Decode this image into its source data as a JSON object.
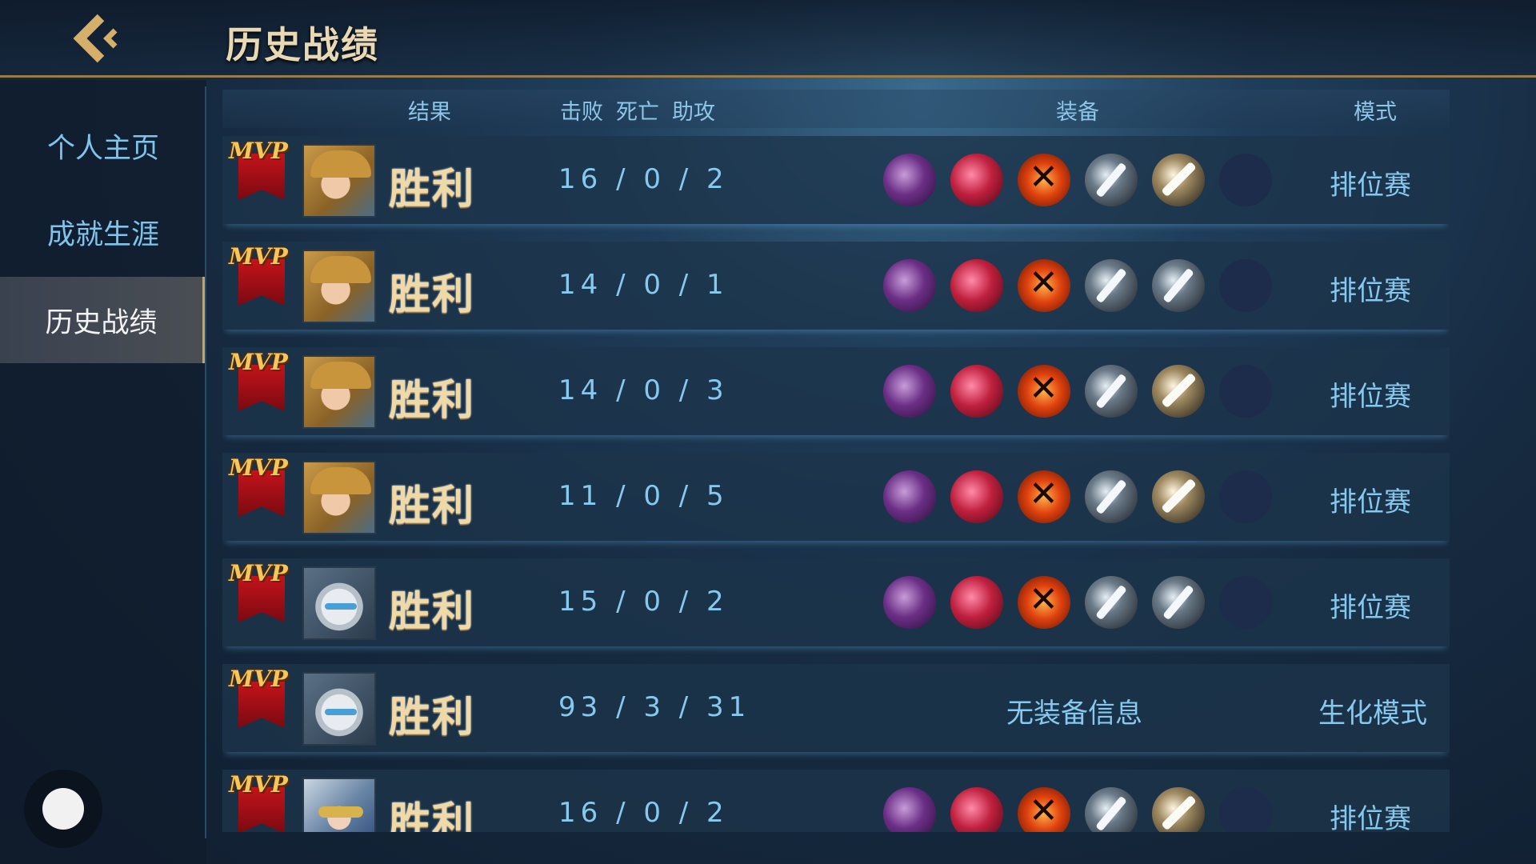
{
  "header": {
    "title": "历史战绩",
    "back_icon": "back-arrow-icon"
  },
  "sidebar": {
    "items": [
      {
        "label": "个人主页",
        "active": false
      },
      {
        "label": "成就生涯",
        "active": false
      },
      {
        "label": "历史战绩",
        "active": true
      }
    ]
  },
  "table": {
    "columns": {
      "result": "结果",
      "kills": "击败",
      "deaths": "死亡",
      "assists": "助攻",
      "equipment": "装备",
      "mode": "模式"
    },
    "rows": [
      {
        "mvp": "MVP",
        "hero": "blonde-heroine",
        "result": "胜利",
        "kda": "16 / 0 / 2",
        "items": [
          "boots",
          "claw",
          "axe",
          "blade",
          "saber",
          "empty"
        ],
        "no_equip": "",
        "mode": "排位赛"
      },
      {
        "mvp": "MVP",
        "hero": "blonde-heroine",
        "result": "胜利",
        "kda": "14 / 0 / 1",
        "items": [
          "boots",
          "claw",
          "axe",
          "blade",
          "blade",
          "empty"
        ],
        "no_equip": "",
        "mode": "排位赛"
      },
      {
        "mvp": "MVP",
        "hero": "blonde-heroine",
        "result": "胜利",
        "kda": "14 / 0 / 3",
        "items": [
          "boots",
          "claw",
          "axe",
          "blade",
          "saber",
          "empty"
        ],
        "no_equip": "",
        "mode": "排位赛"
      },
      {
        "mvp": "MVP",
        "hero": "blonde-heroine",
        "result": "胜利",
        "kda": "11 / 0 / 5",
        "items": [
          "boots",
          "claw",
          "axe",
          "blade",
          "saber",
          "empty"
        ],
        "no_equip": "",
        "mode": "排位赛"
      },
      {
        "mvp": "MVP",
        "hero": "white-beast",
        "result": "胜利",
        "kda": "15 / 0 / 2",
        "items": [
          "boots",
          "claw",
          "axe",
          "blade",
          "blade",
          "empty"
        ],
        "no_equip": "",
        "mode": "排位赛"
      },
      {
        "mvp": "MVP",
        "hero": "white-beast",
        "result": "胜利",
        "kda": "93 / 3 / 31",
        "items": [],
        "no_equip": "无装备信息",
        "mode": "生化模式"
      },
      {
        "mvp": "MVP",
        "hero": "masked-hero",
        "result": "胜利",
        "kda": "16 / 0 / 2",
        "items": [
          "boots",
          "claw",
          "axe",
          "blade",
          "saber",
          "empty"
        ],
        "no_equip": "",
        "mode": "排位赛"
      }
    ]
  }
}
